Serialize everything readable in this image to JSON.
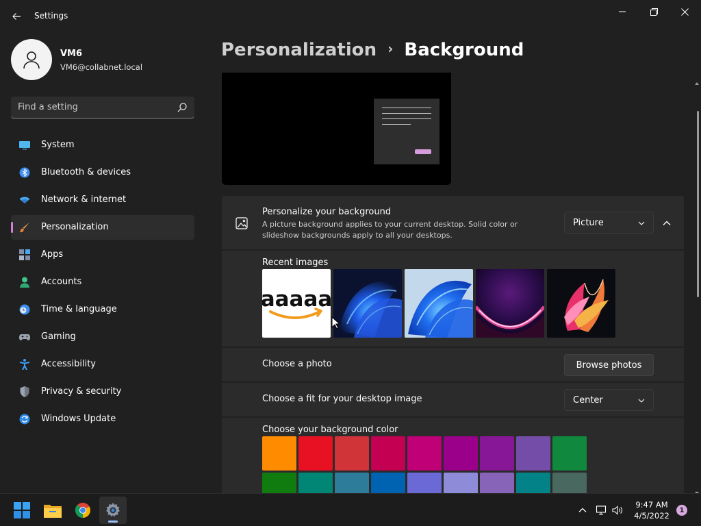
{
  "window": {
    "title": "Settings"
  },
  "profile": {
    "name": "VM6",
    "email": "VM6@collabnet.local"
  },
  "search": {
    "placeholder": "Find a setting"
  },
  "sidebar": {
    "items": [
      {
        "label": "System",
        "icon": "monitor-icon"
      },
      {
        "label": "Bluetooth & devices",
        "icon": "bluetooth-icon"
      },
      {
        "label": "Network & internet",
        "icon": "wifi-icon"
      },
      {
        "label": "Personalization",
        "icon": "brush-icon",
        "selected": true
      },
      {
        "label": "Apps",
        "icon": "apps-icon"
      },
      {
        "label": "Accounts",
        "icon": "person-icon"
      },
      {
        "label": "Time & language",
        "icon": "clock-globe-icon"
      },
      {
        "label": "Gaming",
        "icon": "gamepad-icon"
      },
      {
        "label": "Accessibility",
        "icon": "accessibility-icon"
      },
      {
        "label": "Privacy & security",
        "icon": "shield-icon"
      },
      {
        "label": "Windows Update",
        "icon": "update-icon"
      }
    ]
  },
  "breadcrumb": {
    "parent": "Personalization",
    "separator": "›",
    "current": "Background"
  },
  "personalize_background": {
    "title": "Personalize your background",
    "description": "A picture background applies to your current desktop. Solid color or slideshow backgrounds apply to all your desktops.",
    "selected": "Picture"
  },
  "recent_images": {
    "label": "Recent images",
    "items": [
      {
        "name": "amazon-logo-image",
        "text": "aaaaa"
      },
      {
        "name": "blue-bloom-dark-image"
      },
      {
        "name": "blue-bloom-light-image"
      },
      {
        "name": "purple-glow-image"
      },
      {
        "name": "abstract-ribbon-image"
      }
    ]
  },
  "choose_photo": {
    "label": "Choose a photo",
    "button": "Browse photos"
  },
  "choose_fit": {
    "label": "Choose a fit for your desktop image",
    "selected": "Center"
  },
  "background_color": {
    "label": "Choose your background color",
    "colors": [
      "#ff8c00",
      "#e81123",
      "#d13438",
      "#c30052",
      "#bf0077",
      "#9a0089",
      "#881798",
      "#744da9",
      "#10893e",
      "#107c10",
      "#018574",
      "#2d7d9a",
      "#0063b1",
      "#6b69d6",
      "#8e8cd8",
      "#8764b8",
      "#038387",
      "#486860"
    ]
  },
  "taskbar": {
    "apps": [
      {
        "name": "start-button",
        "icon": "windows-logo-icon"
      },
      {
        "name": "file-explorer-button",
        "icon": "folder-icon"
      },
      {
        "name": "chrome-button",
        "icon": "chrome-icon"
      },
      {
        "name": "settings-app-button",
        "icon": "gear-icon",
        "active": true
      }
    ],
    "time": "9:47 AM",
    "date": "4/5/2022",
    "notifications": "1"
  }
}
